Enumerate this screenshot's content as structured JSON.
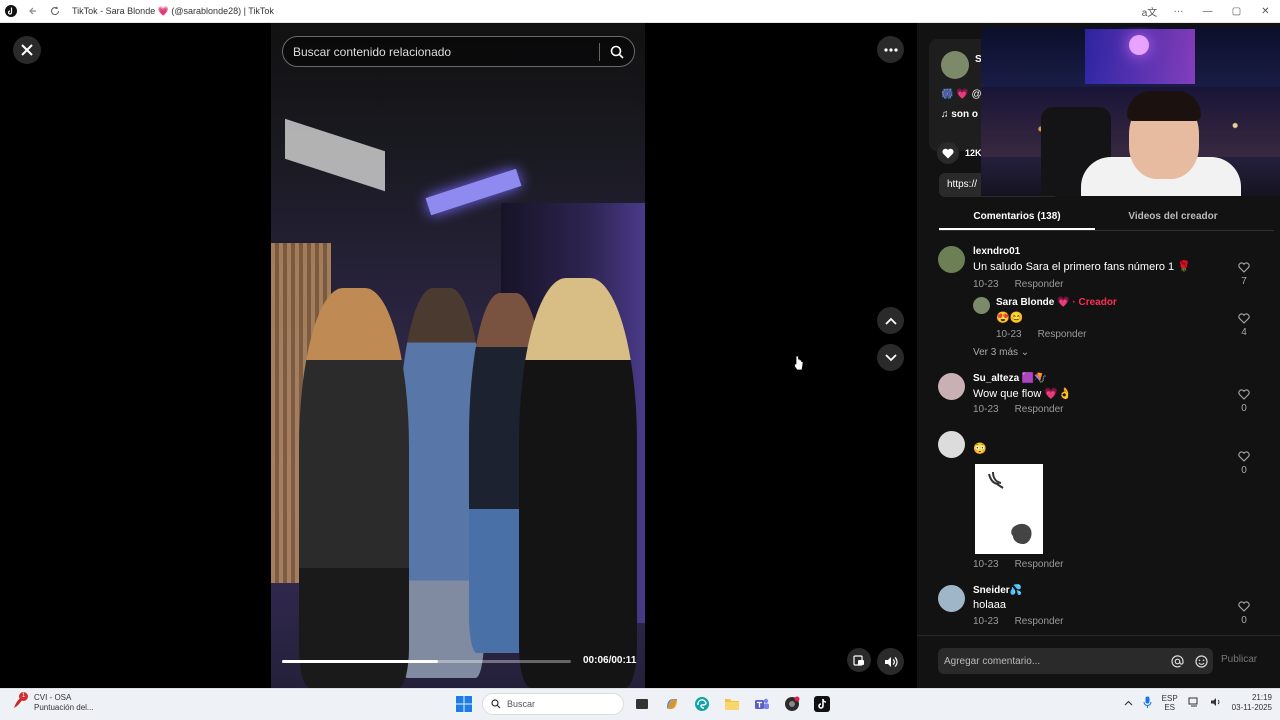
{
  "window": {
    "title": "TikTok - Sara Blonde 💗 (@sarablonde28) | TikTok",
    "controls": {
      "translate": "a文",
      "more": "···",
      "minimize": "—",
      "maximize": "▢",
      "close": "✕"
    }
  },
  "player": {
    "search_placeholder": "Buscar contenido relacionado",
    "time": "00:06/00:11",
    "progress": 0.54
  },
  "creator_card": {
    "username": "S",
    "handle": "S",
    "emoji_line": "🎆 💗 @",
    "music": "♫  son o",
    "likes": "12K",
    "link": "https://"
  },
  "tabs": [
    {
      "label": "Comentarios (138)",
      "active": true
    },
    {
      "label": "Videos del creador",
      "active": false
    }
  ],
  "comments": [
    {
      "user": "lexndro01",
      "text": "Un saludo Sara el primero fans número 1 🌹",
      "date": "10-23",
      "reply": "Responder",
      "likes": "7"
    },
    {
      "user": "Sara Blonde 💗",
      "creator_label": "· Creador",
      "text": "😍😊",
      "date": "10-23",
      "reply": "Responder",
      "likes": "4"
    },
    {
      "more_replies": "Ver 3 más ⌄"
    },
    {
      "user": "Su_alteza 🟪🪁",
      "text": "Wow que flow 💗👌",
      "date": "10-23",
      "reply": "Responder",
      "likes": "0"
    },
    {
      "user": "",
      "text": "😳",
      "date": "10-23",
      "reply": "Responder",
      "likes": "0"
    },
    {
      "user": "Sneider💦",
      "text": "holaaa",
      "date": "10-23",
      "reply": "Responder",
      "likes": "0"
    }
  ],
  "comment_bar": {
    "placeholder": "Agregar comentario...",
    "post": "Publicar"
  },
  "taskbar": {
    "widget_title": "CVI - OSA",
    "widget_sub": "Puntuación del...",
    "widget_badge": "1",
    "search": "Buscar",
    "lang_top": "ESP",
    "lang_bottom": "ES",
    "time": "21:19",
    "date": "03-11-2025"
  },
  "colors": {
    "accent": "#fe2c55",
    "panel": "#121212"
  }
}
